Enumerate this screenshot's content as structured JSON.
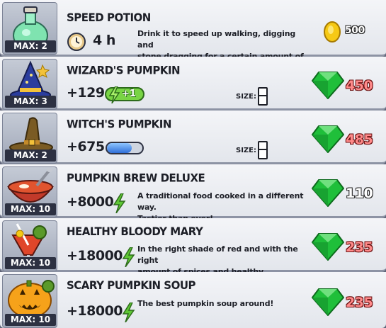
{
  "items": [
    {
      "title": "SPEED POTION",
      "max": "MAX: 2",
      "duration": "4 h",
      "description": [
        "Drink it to speed up walking, digging and",
        "stone dragging for a certain amount of time."
      ],
      "price": "500",
      "currency": "coin-icon",
      "thumb_icon": "potion-icon"
    },
    {
      "title": "WIZARD'S PUMPKIN",
      "max": "MAX: 3",
      "value": "+129",
      "energy_badge": "+1",
      "size_label": "SIZE:",
      "price": "450",
      "currency": "gem-icon",
      "thumb_icon": "wizard-hat-icon"
    },
    {
      "title": "WITCH'S PUMPKIN",
      "max": "MAX: 2",
      "value": "+675",
      "size_label": "SIZE:",
      "price": "485",
      "currency": "gem-icon",
      "thumb_icon": "witch-hat-icon"
    },
    {
      "title": "PUMPKIN BREW DELUXE",
      "max": "MAX: 10",
      "value": "+8000",
      "description": [
        "A traditional food cooked in a different way.",
        "Tastier than ever!"
      ],
      "price": "110",
      "currency": "gem-icon",
      "thumb_icon": "soup-bowl-icon"
    },
    {
      "title": "HEALTHY BLOODY MARY",
      "max": "MAX: 10",
      "value": "+18000",
      "description": [
        "In the right shade of red and with the right",
        "amount of spices and healthy vitamins!"
      ],
      "price": "235",
      "currency": "gem-icon",
      "thumb_icon": "cocktail-icon"
    },
    {
      "title": "SCARY PUMPKIN SOUP",
      "max": "MAX: 10",
      "value": "+18000",
      "description": [
        "The best pumpkin soup around!"
      ],
      "price": "235",
      "currency": "gem-icon",
      "thumb_icon": "pumpkin-soup-icon"
    }
  ],
  "colors": {
    "row_bg": "#e9ebf0",
    "max_badge": "#2d3142",
    "gem_price": "#ff8a8a",
    "gem": "#1fbf3a",
    "coin": "#f6c915",
    "energy": "#5ec634"
  }
}
